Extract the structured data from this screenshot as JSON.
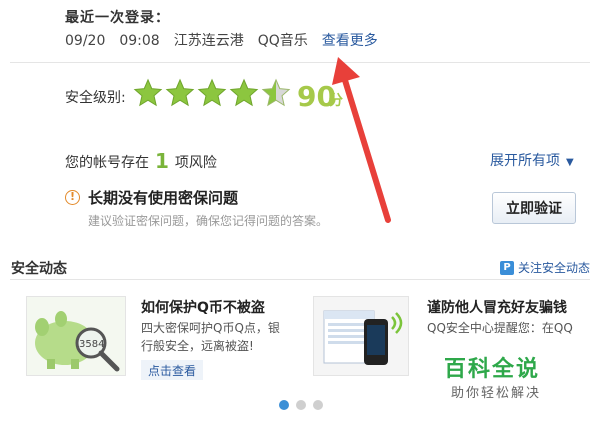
{
  "last_login": {
    "title": "最近一次登录：",
    "date": "09/20",
    "time": "09:08",
    "location": "江苏连云港",
    "app": "QQ音乐",
    "more_link": "查看更多"
  },
  "security_level": {
    "label": "安全级别:",
    "score": "90",
    "unit": "分",
    "stars_full": 4,
    "stars_half": 1,
    "stars_total": 5,
    "star_color": "#8cc63f"
  },
  "risk": {
    "prefix": "您的帐号存在",
    "count": "1",
    "suffix": "项风险",
    "expand_all": "展开所有项",
    "item_title": "长期没有使用密保问题",
    "item_desc": "建议验证密保问题，确保您记得问题的答案。",
    "verify_button": "立即验证"
  },
  "news": {
    "section_title": "安全动态",
    "follow_label": "关注安全动态",
    "cards": [
      {
        "title": "如何保护Q币不被盗",
        "desc": "四大密保呵护Q币Q点，银行般安全，远离被盗!",
        "link": "点击查看",
        "image_text": "3584"
      },
      {
        "title": "谨防他人冒充好友骗钱",
        "desc": "QQ安全中心提醒您：在QQ"
      }
    ]
  },
  "watermark": {
    "main": "百科全说",
    "sub": "助你轻松解决"
  },
  "carousel": {
    "active_index": 0,
    "count": 3
  },
  "colors": {
    "accent_green": "#a6c94a",
    "link_blue": "#2a5a9f",
    "arrow_red": "#e8403a"
  }
}
